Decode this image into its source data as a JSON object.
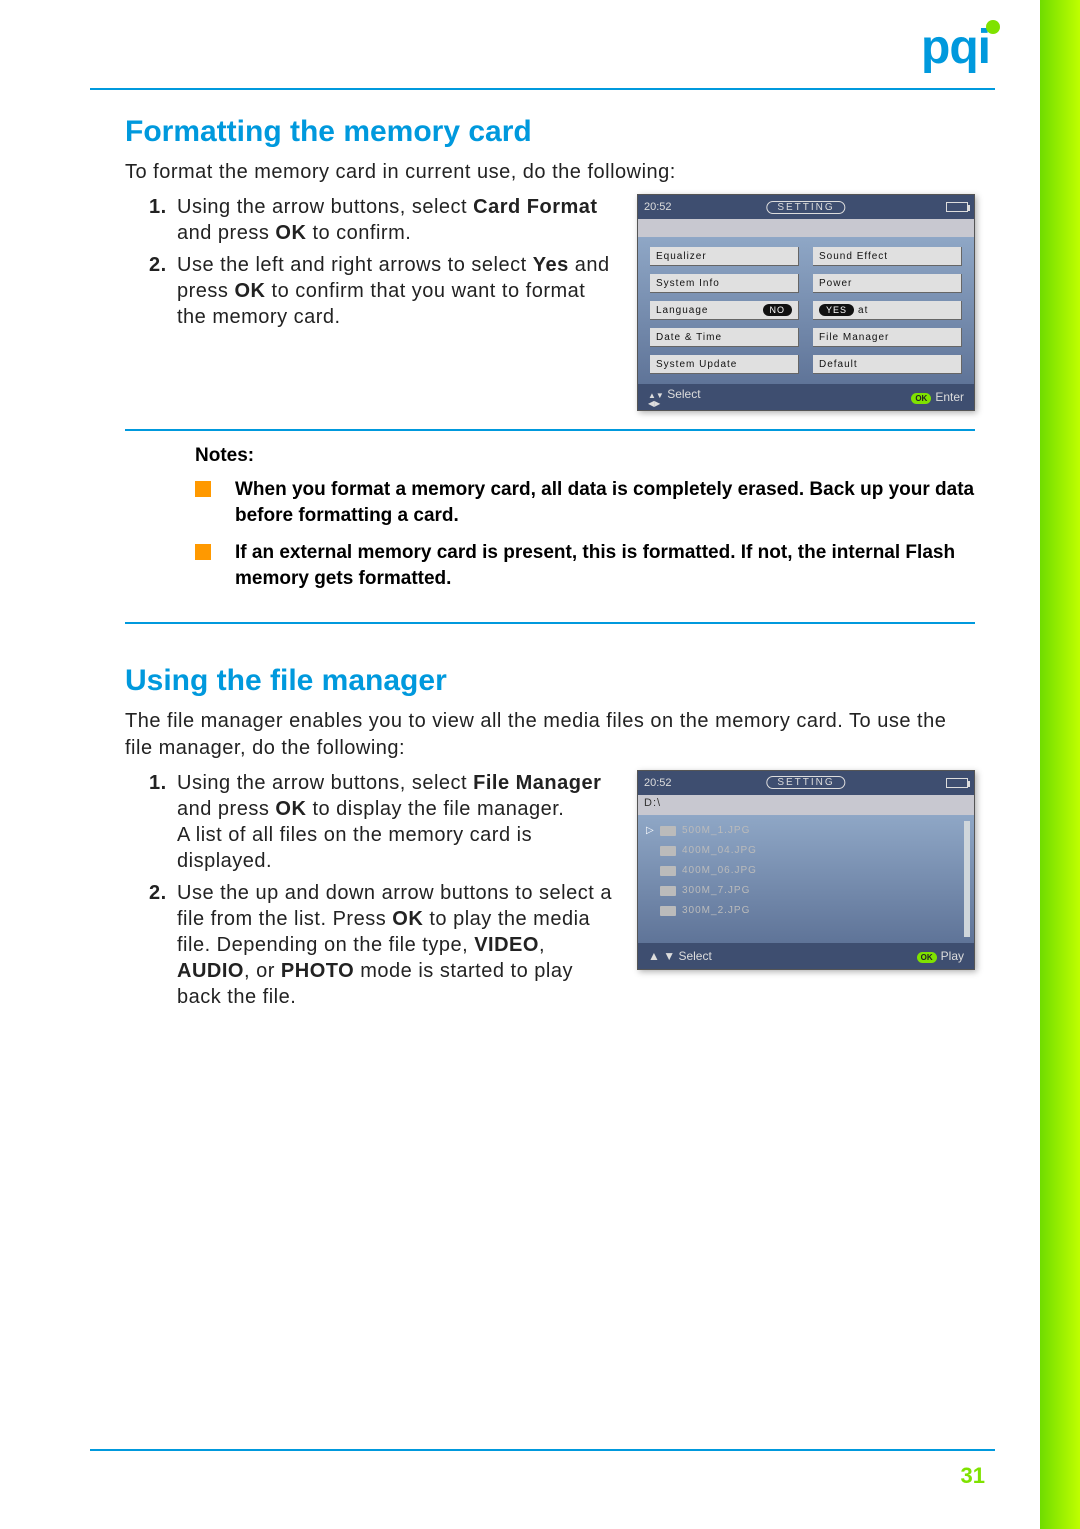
{
  "page_number": "31",
  "logo": "pqi",
  "section1": {
    "heading": "Formatting the memory card",
    "intro": "To format the memory card in current use, do the following:",
    "steps": [
      {
        "num": "1.",
        "pre": "Using the arrow buttons, select ",
        "b1": "Card Format",
        "mid": " and press ",
        "b2": "OK",
        "post": " to confirm."
      },
      {
        "num": "2.",
        "pre": "Use the left and right arrows to select ",
        "b1": "Yes",
        "mid": " and press ",
        "b2": "OK",
        "post": " to confirm that you want to format the memory card."
      }
    ]
  },
  "notes": {
    "title": "Notes:",
    "items": [
      "When you format a memory card, all data is completely erased. Back up your data before formatting a card.",
      "If an external memory card is present, this is formatted. If not, the internal Flash memory gets formatted."
    ]
  },
  "section2": {
    "heading": "Using the file manager",
    "intro": "The file manager enables you to view all the media files on the memory card. To use the file manager, do the following:",
    "step1": {
      "num": "1.",
      "pre": "Using the arrow buttons, select ",
      "b1": "File Manager",
      "mid": " and press ",
      "b2": "OK",
      "post1": " to display the file manager.",
      "line2": "A list of all files on the memory card is displayed."
    },
    "step2": {
      "num": "2.",
      "pre": "Use the up and down arrow buttons to select a file from the list. Press ",
      "b1": "OK",
      "mid1": " to play the media file. Depending on the file type, ",
      "v": "VIDEO",
      "a": "AUDIO",
      "p": "PHOTO",
      "post": " mode is started to play back the file.",
      "comma1": ", ",
      "or": ", or "
    }
  },
  "device1": {
    "time": "20:52",
    "title": "SETTING",
    "left": [
      "Equalizer",
      "System Info",
      "Language",
      "Date & Time",
      "System Update"
    ],
    "right": [
      "Sound Effect",
      "Power",
      "at",
      "File Manager",
      "Default"
    ],
    "no": "NO",
    "yes": "YES",
    "foot_select": "Select",
    "foot_enter": "Enter",
    "ok": "OK"
  },
  "device2": {
    "time": "20:52",
    "title": "SETTING",
    "path": "D:\\",
    "files": [
      "500M_1.JPG",
      "400M_04.JPG",
      "400M_06.JPG",
      "300M_7.JPG",
      "300M_2.JPG"
    ],
    "foot_select": "Select",
    "foot_play": "Play",
    "ok": "OK"
  }
}
